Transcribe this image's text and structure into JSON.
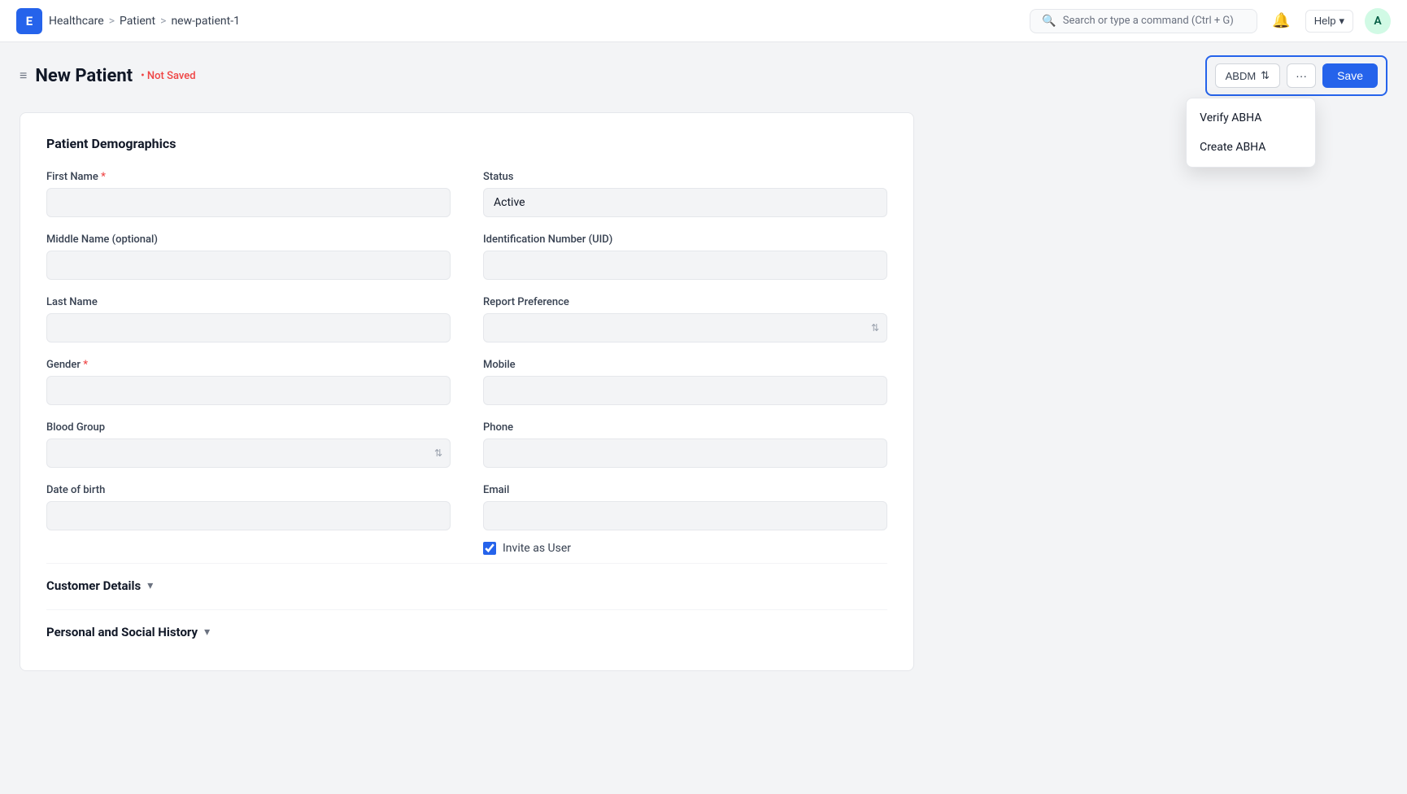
{
  "app": {
    "logo": "E",
    "logo_bg": "#2563eb"
  },
  "breadcrumb": {
    "items": [
      "Healthcare",
      "Patient",
      "new-patient-1"
    ],
    "separators": [
      ">",
      ">",
      ">"
    ]
  },
  "search": {
    "placeholder": "Search or type a command (Ctrl + G)"
  },
  "topnav": {
    "bell_icon": "🔔",
    "help_label": "Help",
    "help_chevron": "▾",
    "avatar_label": "A"
  },
  "page": {
    "menu_icon": "≡",
    "title": "New Patient",
    "not_saved_label": "• Not Saved"
  },
  "toolbar": {
    "abdm_label": "ABDM",
    "abdm_arrows": "⇅",
    "more_label": "···",
    "save_label": "Save"
  },
  "dropdown": {
    "items": [
      {
        "label": "Verify ABHA"
      },
      {
        "label": "Create ABHA"
      }
    ]
  },
  "form": {
    "section_title": "Patient Demographics",
    "fields": {
      "first_name_label": "First Name",
      "first_name_required": true,
      "middle_name_label": "Middle Name (optional)",
      "last_name_label": "Last Name",
      "gender_label": "Gender",
      "gender_required": true,
      "blood_group_label": "Blood Group",
      "date_of_birth_label": "Date of birth",
      "status_label": "Status",
      "status_value": "Active",
      "identification_label": "Identification Number (UID)",
      "report_preference_label": "Report Preference",
      "mobile_label": "Mobile",
      "phone_label": "Phone",
      "email_label": "Email",
      "invite_as_user_label": "Invite as User",
      "invite_as_user_checked": true
    }
  },
  "accordions": [
    {
      "label": "Customer Details",
      "icon": "▾"
    },
    {
      "label": "Personal and Social History",
      "icon": "▾"
    }
  ]
}
